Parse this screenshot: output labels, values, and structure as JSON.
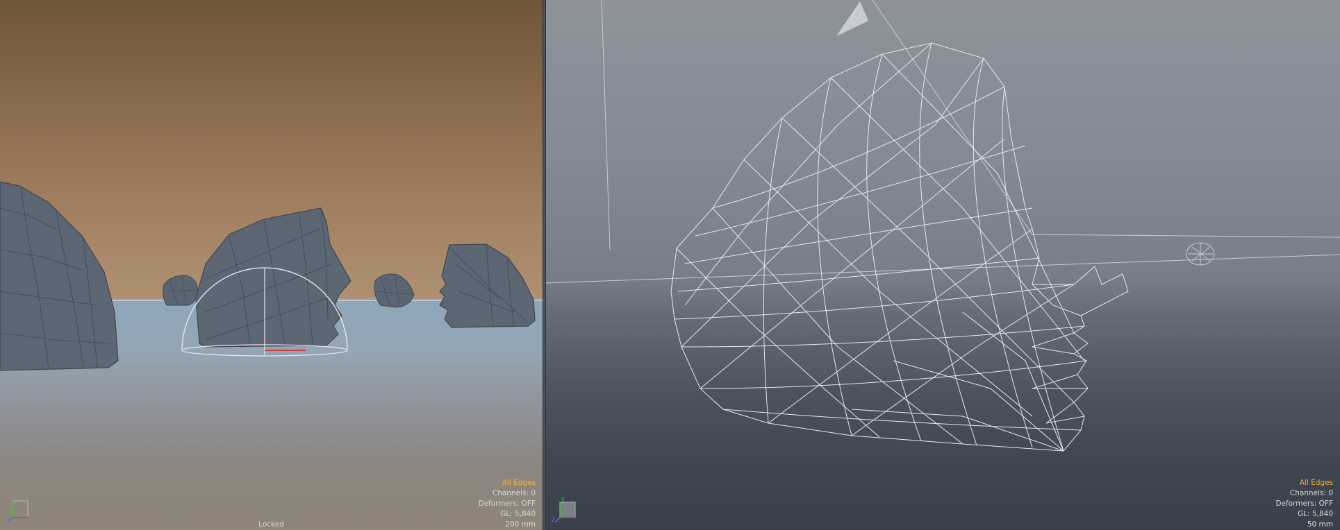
{
  "left_viewport": {
    "hud": {
      "mode": "All Edges",
      "channels": "Channels: 0",
      "deformers": "Deformers: OFF",
      "gl": "GL: 5,840",
      "scale": "200 mm"
    },
    "status": "Locked"
  },
  "right_viewport": {
    "hud": {
      "mode": "All Edges",
      "channels": "Channels: 0",
      "deformers": "Deformers: OFF",
      "gl": "GL: 5,840",
      "scale": "50 mm"
    },
    "axis": {
      "y": "Y",
      "z": "Z"
    }
  },
  "colors": {
    "mode_text": "#f3b43b",
    "hud_text": "#d8d8d8",
    "mesh_fill": "#5f6875",
    "wire": "#e6e9ee",
    "axis_x": "#d23a3a",
    "axis_y": "#44c244",
    "axis_z": "#4f6ef0"
  },
  "icons": [
    "axis-gizmo-icon",
    "light-gizmo-icon",
    "camera-icon"
  ]
}
